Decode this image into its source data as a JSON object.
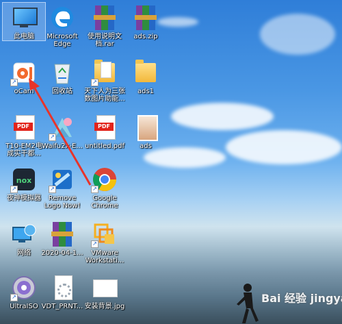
{
  "desktop": {
    "icons": [
      {
        "label": "此电脑",
        "icon": "computer-icon"
      },
      {
        "label": "Microsoft\nEdge",
        "icon": "edge-icon"
      },
      {
        "label": "使用说明文\n档.rar",
        "icon": "winrar-icon"
      },
      {
        "label": "ads.zip",
        "icon": "winrar-icon"
      },
      {
        "label": "oCam",
        "icon": "ocam-icon"
      },
      {
        "label": "回收站",
        "icon": "recycle-bin-icon"
      },
      {
        "label": "天下人为三张\n数图片助能...",
        "icon": "folder-icon"
      },
      {
        "label": "ads1",
        "icon": "folder-icon"
      },
      {
        "label": "T10-EM2电\n成实干都...",
        "icon": "pdf-icon"
      },
      {
        "label": "Waifu2x-E...",
        "icon": "waifu2x-icon"
      },
      {
        "label": "untitled.pdf",
        "icon": "pdf-icon"
      },
      {
        "label": "ads",
        "icon": "image-file-icon"
      },
      {
        "label": "夜神模拟器",
        "icon": "nox-icon"
      },
      {
        "label": "Remove\nLogo Now!",
        "icon": "remove-logo-icon"
      },
      {
        "label": "Google\nChrome",
        "icon": "chrome-icon"
      },
      {
        "label": "网络",
        "icon": "network-icon"
      },
      {
        "label": "2020-04-1...",
        "icon": "winrar-icon"
      },
      {
        "label": "VMware\nWorkstati...",
        "icon": "vmware-icon"
      },
      {
        "label": "UltraISO",
        "icon": "ultraiso-icon"
      },
      {
        "label": "VDT_PRNT...",
        "icon": "settings-file-icon"
      },
      {
        "label": "安装背景.jpg",
        "icon": "image-file-icon"
      }
    ],
    "annotation": {
      "type": "arrow",
      "color": "#e8342a"
    },
    "watermark": "Bai 经验 jingyan.baidu.com"
  },
  "colors": {
    "arrow": "#e8342a",
    "selection": "#a0c4f0"
  }
}
